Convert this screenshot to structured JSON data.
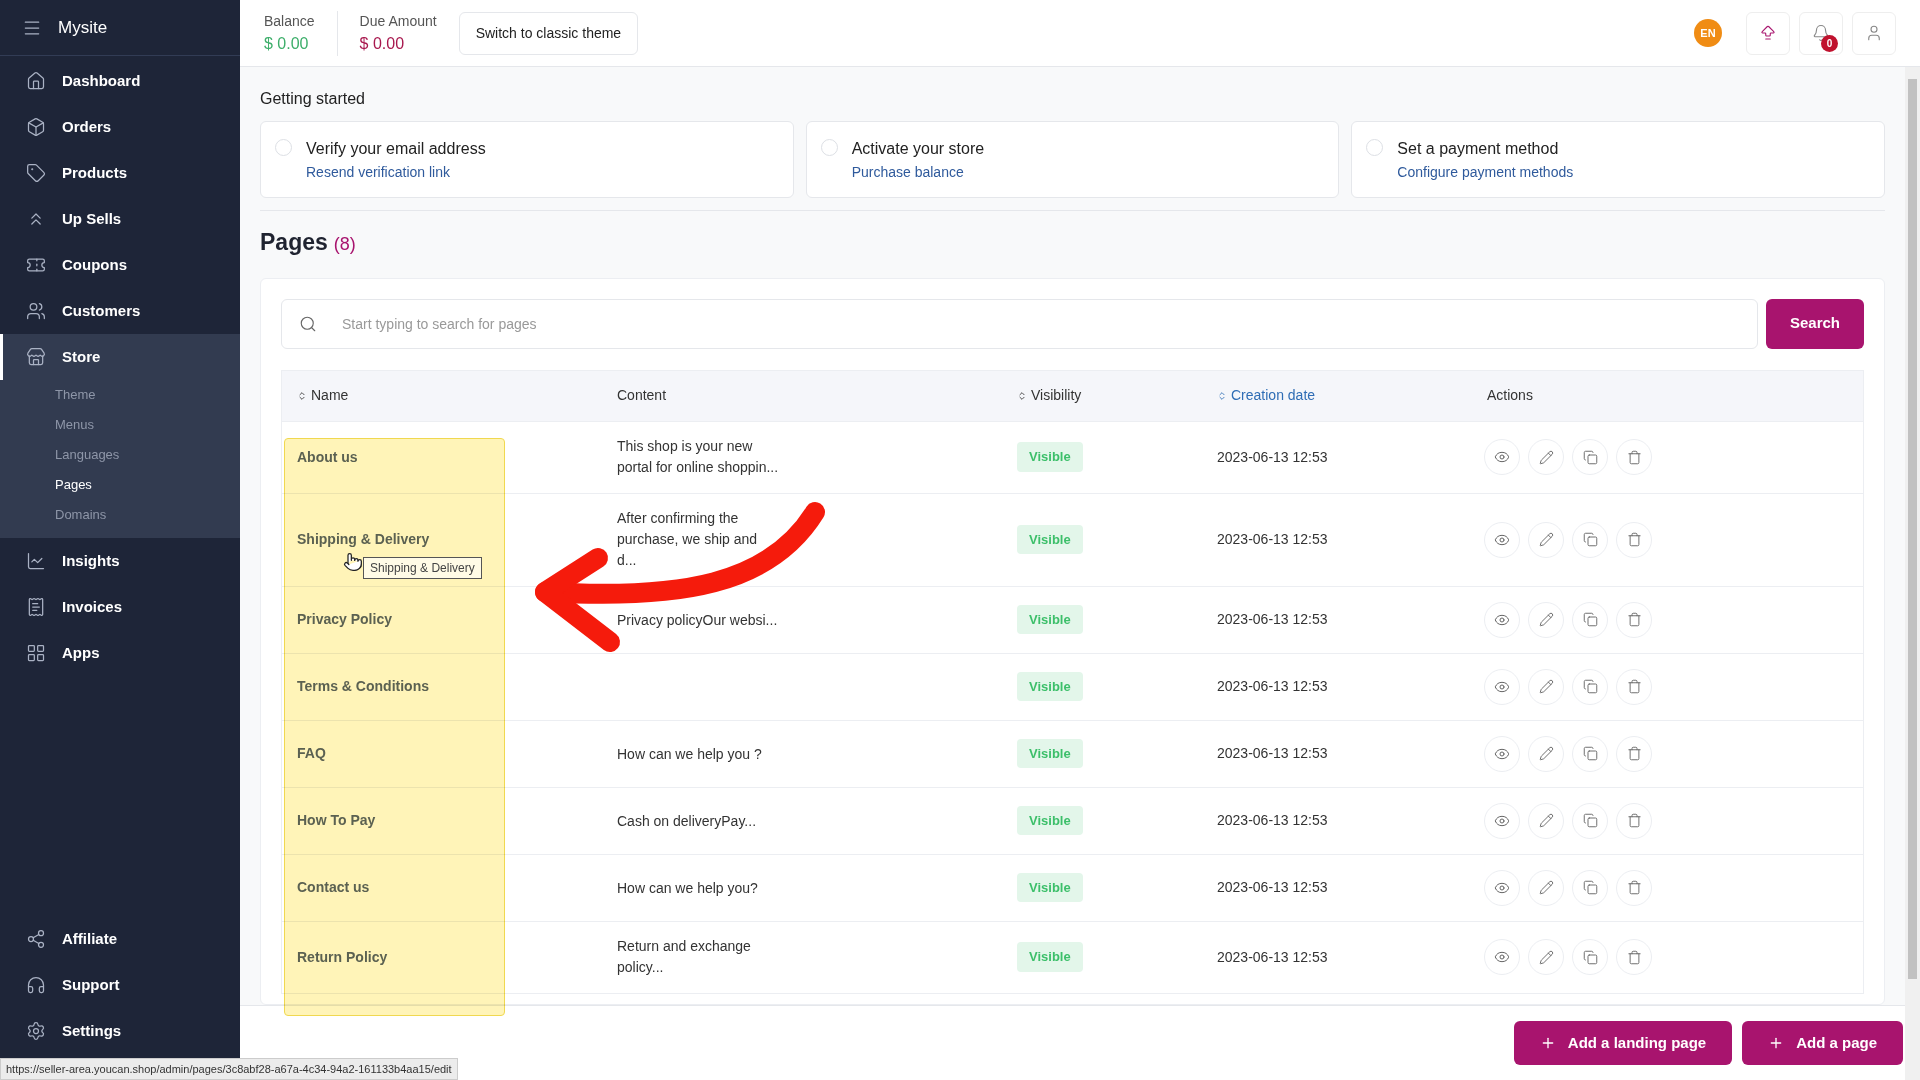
{
  "sidebar": {
    "title": "Mysite",
    "items": [
      {
        "label": "Dashboard",
        "selected": false
      },
      {
        "label": "Orders",
        "selected": false
      },
      {
        "label": "Products",
        "selected": false
      },
      {
        "label": "Up Sells",
        "selected": false
      },
      {
        "label": "Coupons",
        "selected": false
      },
      {
        "label": "Customers",
        "selected": false
      },
      {
        "label": "Store",
        "selected": true,
        "children": [
          {
            "label": "Theme",
            "selected": false
          },
          {
            "label": "Menus",
            "selected": false
          },
          {
            "label": "Languages",
            "selected": false
          },
          {
            "label": "Pages",
            "selected": true
          },
          {
            "label": "Domains",
            "selected": false
          }
        ]
      },
      {
        "label": "Insights",
        "selected": false
      },
      {
        "label": "Invoices",
        "selected": false
      },
      {
        "label": "Apps",
        "selected": false
      }
    ],
    "footer_items": [
      {
        "label": "Affiliate"
      },
      {
        "label": "Support"
      },
      {
        "label": "Settings"
      }
    ]
  },
  "topbar": {
    "balance_label": "Balance",
    "balance_value": "$ 0.00",
    "due_label": "Due Amount",
    "due_value": "$ 0.00",
    "theme_button": "Switch to classic theme",
    "language": "EN",
    "notification_count": "0"
  },
  "getting_started": {
    "title": "Getting started",
    "steps": [
      {
        "title": "Verify your email address",
        "link": "Resend verification link",
        "checked": false
      },
      {
        "title": "Activate your store",
        "link": "Purchase balance",
        "checked": false
      },
      {
        "title": "Set a payment method",
        "link": "Configure payment methods",
        "checked": false
      }
    ]
  },
  "pages": {
    "title": "Pages",
    "count": "(8)",
    "search": {
      "placeholder": "Start typing to search for pages",
      "button": "Search"
    },
    "columns": [
      {
        "label": "Name",
        "sortable": true,
        "active": false
      },
      {
        "label": "Content",
        "sortable": false,
        "active": false
      },
      {
        "label": "Visibility",
        "sortable": true,
        "active": false
      },
      {
        "label": "Creation date",
        "sortable": true,
        "active": true
      },
      {
        "label": "Actions",
        "sortable": false,
        "active": false
      }
    ],
    "rows": [
      {
        "name": "About us",
        "content": [
          "This shop is your new",
          "portal for online shoppin..."
        ],
        "visibility": "Visible",
        "created": "2023-06-13 12:53"
      },
      {
        "name": "Shipping & Delivery",
        "content": [
          "After confirming the",
          "purchase, we ship and",
          "d..."
        ],
        "visibility": "Visible",
        "created": "2023-06-13 12:53"
      },
      {
        "name": "Privacy Policy",
        "content": [
          "Privacy policyOur websi..."
        ],
        "visibility": "Visible",
        "created": "2023-06-13 12:53"
      },
      {
        "name": "Terms & Conditions",
        "content": [],
        "visibility": "Visible",
        "created": "2023-06-13 12:53"
      },
      {
        "name": "FAQ",
        "content": [
          "How can we help you ?"
        ],
        "visibility": "Visible",
        "created": "2023-06-13 12:53"
      },
      {
        "name": "How To Pay",
        "content": [
          "Cash on deliveryPay..."
        ],
        "visibility": "Visible",
        "created": "2023-06-13 12:53"
      },
      {
        "name": "Contact us",
        "content": [
          "How can we help you?"
        ],
        "visibility": "Visible",
        "created": "2023-06-13 12:53"
      },
      {
        "name": "Return Policy",
        "content": [
          "Return and exchange",
          "policy..."
        ],
        "visibility": "Visible",
        "created": "2023-06-13 12:53"
      }
    ],
    "tooltip": "Shipping & Delivery"
  },
  "actions": [
    "Add a landing page",
    "Add a page"
  ],
  "status_url": "https://seller-area.youcan.shop/admin/pages/3c8abf28-a67a-4c34-94a2-161133b4aa15/edit"
}
